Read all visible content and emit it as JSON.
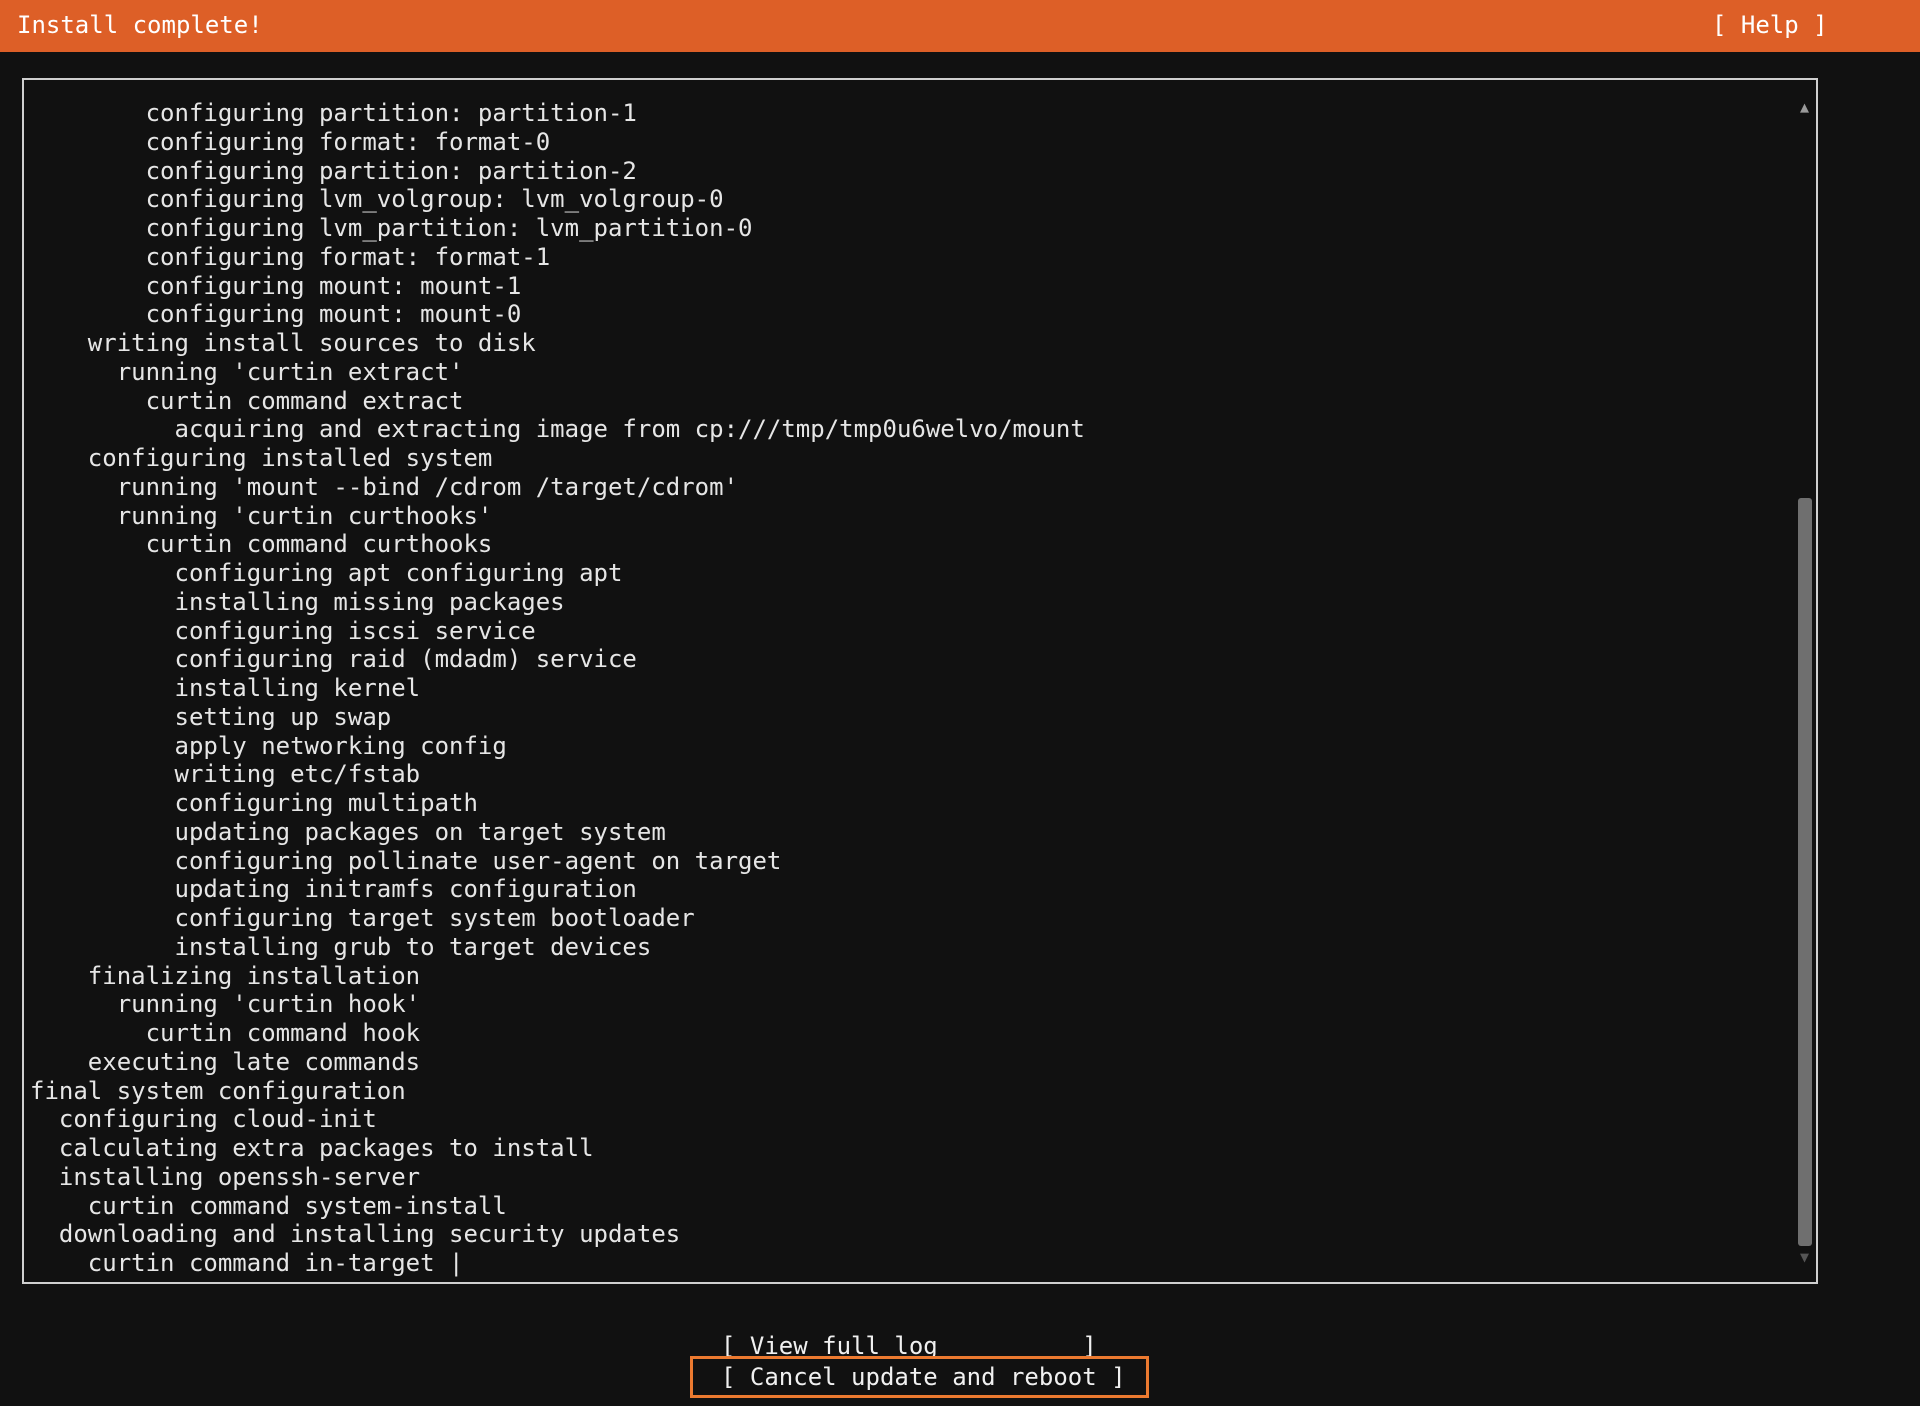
{
  "header": {
    "title": "Install complete!",
    "help_label": "[ Help ]"
  },
  "colors": {
    "header_bg": "#dd5f27",
    "background": "#111111",
    "focus_outline": "#ec7a30",
    "text": "#e6e6e6"
  },
  "log": {
    "lines": [
      "        configuring partition: partition-1",
      "        configuring format: format-0",
      "        configuring partition: partition-2",
      "        configuring lvm_volgroup: lvm_volgroup-0",
      "        configuring lvm_partition: lvm_partition-0",
      "        configuring format: format-1",
      "        configuring mount: mount-1",
      "        configuring mount: mount-0",
      "    writing install sources to disk",
      "      running 'curtin extract'",
      "        curtin command extract",
      "          acquiring and extracting image from cp:///tmp/tmp0u6welvo/mount",
      "    configuring installed system",
      "      running 'mount --bind /cdrom /target/cdrom'",
      "      running 'curtin curthooks'",
      "        curtin command curthooks",
      "          configuring apt configuring apt",
      "          installing missing packages",
      "          configuring iscsi service",
      "          configuring raid (mdadm) service",
      "          installing kernel",
      "          setting up swap",
      "          apply networking config",
      "          writing etc/fstab",
      "          configuring multipath",
      "          updating packages on target system",
      "          configuring pollinate user-agent on target",
      "          updating initramfs configuration",
      "          configuring target system bootloader",
      "          installing grub to target devices",
      "    finalizing installation",
      "      running 'curtin hook'",
      "        curtin command hook",
      "    executing late commands",
      "final system configuration",
      "  configuring cloud-init",
      "  calculating extra packages to install",
      "  installing openssh-server",
      "    curtin command system-install",
      "  downloading and installing security updates",
      "    curtin command in-target |"
    ],
    "scroll_up_glyph": "▲",
    "scroll_down_glyph": "▼"
  },
  "buttons": {
    "view_log_label": "[ View full log          ]",
    "cancel_label": "[ Cancel update and reboot ]"
  }
}
